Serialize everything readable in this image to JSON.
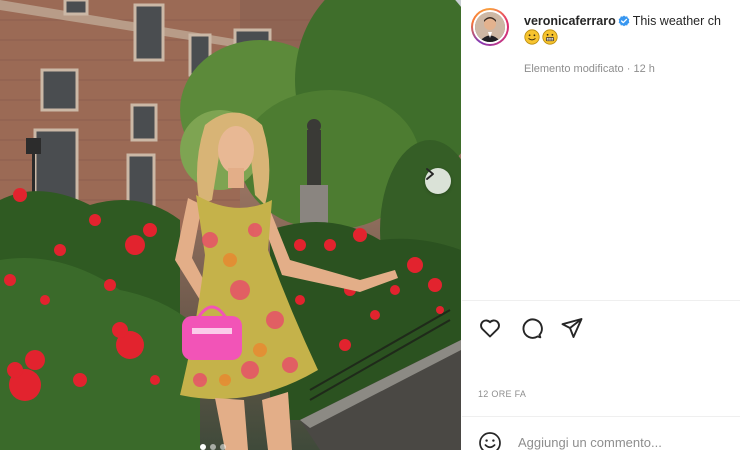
{
  "post": {
    "username": "veronicaferraro",
    "verified": true,
    "caption_preview": "This weather ch",
    "emojis": [
      "slightly-smiling-face",
      "grinning-face"
    ],
    "edited_label": "Elemento modificato",
    "separator": "·",
    "age": "12 h",
    "timestamp": "12 ORE FA",
    "image_count": 3,
    "active_image": 1
  },
  "actions": {
    "like_icon": "heart-icon",
    "comment_icon": "comment-icon",
    "share_icon": "send-icon"
  },
  "comment_box": {
    "placeholder": "Aggiungi un commento..."
  },
  "colors": {
    "verified_blue": "#3897f0",
    "text_primary": "#262626",
    "text_secondary": "#8e8e8e",
    "divider": "#efefef"
  }
}
